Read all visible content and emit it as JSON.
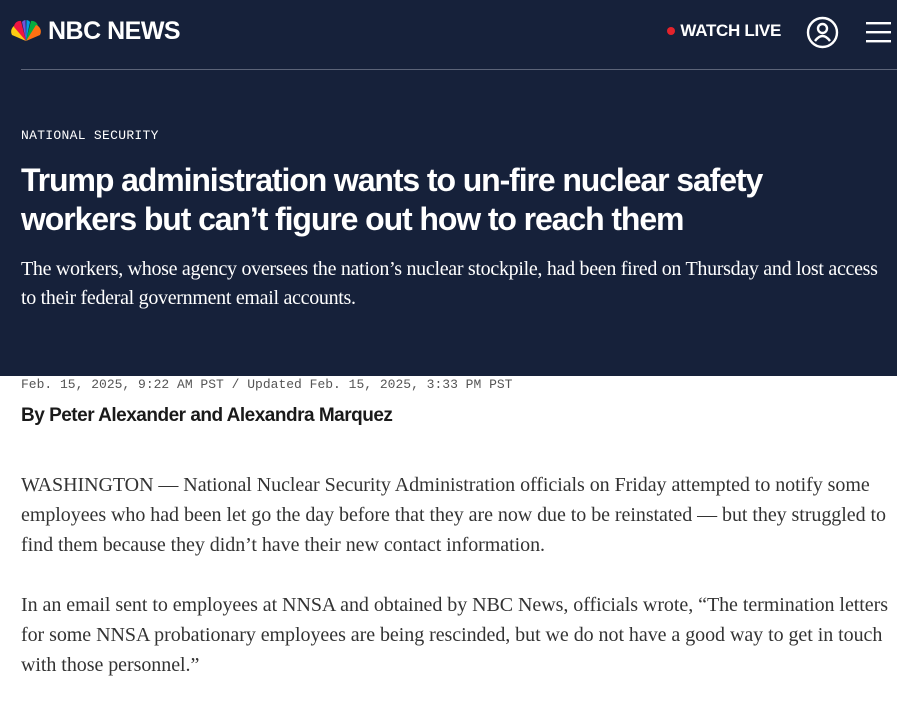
{
  "header": {
    "brand": "NBC NEWS",
    "watch_live": "WATCH LIVE",
    "live_dot_color": "#e4232b",
    "account_icon": "user-circle-icon",
    "menu_icon": "hamburger-menu-icon"
  },
  "article": {
    "section": "NATIONAL SECURITY",
    "headline": "Trump administration wants to un-fire nuclear safety workers but can’t figure out how to reach them",
    "dek": "The workers, whose agency oversees the nation’s nuclear stockpile, had been fired on Thursday and lost access to their federal government email accounts.",
    "timestamp": "Feb. 15, 2025, 9:22 AM PST / Updated Feb. 15, 2025, 3:33 PM PST",
    "byline": "By Peter Alexander and Alexandra Marquez",
    "paragraphs": [
      "WASHINGTON — National Nuclear Security Administration officials on Friday attempted to notify some employees who had been let go the day before that they are now due to be reinstated — but they struggled to find them because they didn’t have their new contact information.",
      "In an email sent to employees at NNSA and obtained by NBC News, officials wrote, “The termination letters for some NNSA probationary employees are being rescinded, but we do not have a good way to get in touch with those personnel.”"
    ]
  },
  "colors": {
    "header_bg": "#16213a",
    "text_dark": "#1a1a1a"
  }
}
